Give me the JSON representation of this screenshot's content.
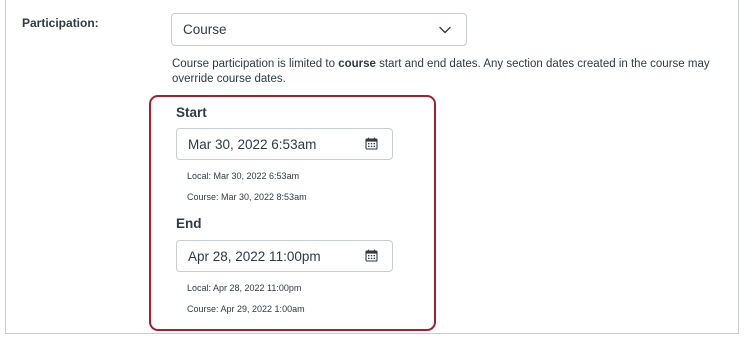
{
  "participation": {
    "label": "Participation:",
    "selected": "Course",
    "help_before": "Course participation is limited to ",
    "help_bold": "course",
    "help_after": " start and end dates. Any section dates created in the course may override course dates."
  },
  "start": {
    "title": "Start",
    "value": "Mar 30, 2022 6:53am",
    "local": "Local: Mar 30, 2022 6:53am",
    "course": "Course: Mar 30, 2022 8:53am"
  },
  "end": {
    "title": "End",
    "value": "Apr 28, 2022 11:00pm",
    "local": "Local: Apr 28, 2022 11:00pm",
    "course": "Course: Apr 29, 2022 1:00am"
  },
  "icons": {
    "select_arrow": "chevron-down-icon",
    "date_picker": "calendar-icon"
  },
  "colors": {
    "highlight_border": "#a91e2e",
    "text": "#2d3b45",
    "input_border": "#c7cdd1"
  }
}
